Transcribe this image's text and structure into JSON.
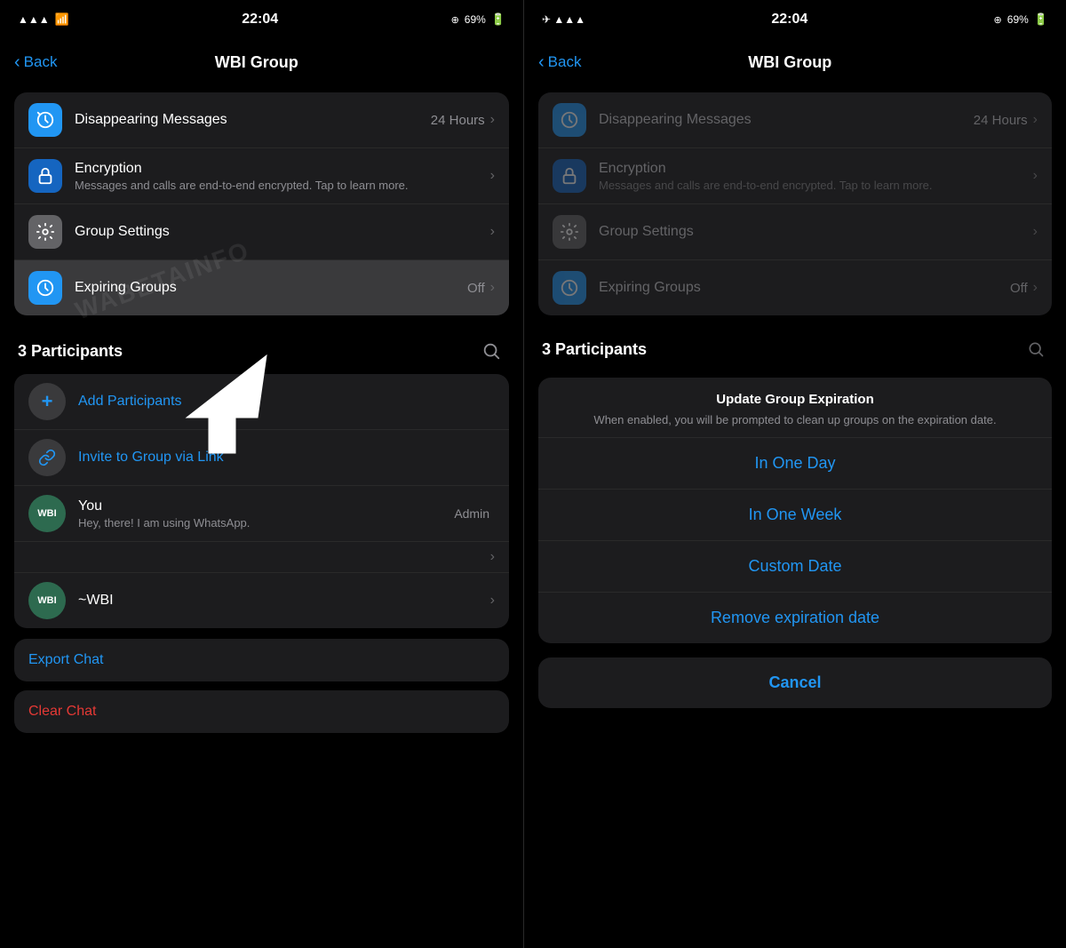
{
  "left": {
    "status": {
      "time": "22:04",
      "battery": "69%"
    },
    "nav": {
      "back": "Back",
      "title": "WBI Group"
    },
    "settings": {
      "rows": [
        {
          "icon": "🔵",
          "icon_type": "blue",
          "title": "Disappearing Messages",
          "value": "24 Hours",
          "has_chevron": true
        },
        {
          "icon": "🔒",
          "icon_type": "dark-blue",
          "title": "Encryption",
          "subtitle": "Messages and calls are end-to-end encrypted. Tap to learn more.",
          "has_chevron": true
        },
        {
          "icon": "⚙",
          "icon_type": "gear",
          "title": "Group Settings",
          "has_chevron": true
        },
        {
          "icon": "🔵",
          "icon_type": "blue",
          "title": "Expiring Groups",
          "value": "Off",
          "has_chevron": true,
          "selected": true
        }
      ]
    },
    "participants": {
      "title": "3 Participants",
      "rows": [
        {
          "type": "add",
          "name": "Add Participants"
        },
        {
          "type": "link",
          "name": "Invite to Group via Link"
        },
        {
          "type": "user",
          "avatar": "WBI",
          "name": "You",
          "status": "Hey, there! I am using WhatsApp.",
          "badge": "Admin"
        },
        {
          "type": "user",
          "avatar": "WBI",
          "name": "~WBI",
          "has_chevron": true
        }
      ]
    },
    "actions": {
      "export": "Export Chat",
      "clear": "Clear Chat"
    }
  },
  "right": {
    "status": {
      "time": "22:04",
      "battery": "69%"
    },
    "nav": {
      "back": "Back",
      "title": "WBI Group"
    },
    "settings": {
      "rows": [
        {
          "title": "Disappearing Messages",
          "value": "24 Hours"
        },
        {
          "title": "Encryption",
          "subtitle": "Messages and calls are end-to-end encrypted. Tap to learn more."
        },
        {
          "title": "Group Settings"
        },
        {
          "title": "Expiring Groups",
          "value": "Off"
        }
      ]
    },
    "participants": {
      "title": "3 Participants"
    },
    "modal": {
      "title": "Update Group Expiration",
      "subtitle": "When enabled, you will be prompted to clean up groups on the expiration date.",
      "options": [
        "In One Day",
        "In One Week",
        "Custom Date",
        "Remove expiration date"
      ],
      "cancel": "Cancel"
    }
  }
}
